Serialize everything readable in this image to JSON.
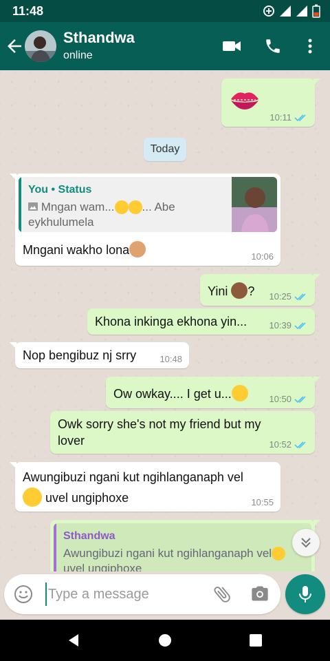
{
  "status_bar": {
    "time": "11:48"
  },
  "header": {
    "contact_name": "Sthandwa",
    "presence": "online"
  },
  "date_divider": "Today",
  "messages": [
    {
      "dir": "out",
      "text": "💋",
      "time": "10:11",
      "ticks": "read"
    },
    {
      "dir": "in",
      "quote_author": "You • Status",
      "quote_line1": "Mngan wam...",
      "quote_line1_tail": "... Abe",
      "quote_line2": "eykhulumela",
      "text": "Mngani wakho lona",
      "time": "10:06"
    },
    {
      "dir": "out",
      "text": "Yini",
      "text_tail": "?",
      "time": "10:25",
      "ticks": "read"
    },
    {
      "dir": "out",
      "text": "Khona inkinga ekhona yin...",
      "time": "10:39",
      "ticks": "read"
    },
    {
      "dir": "in",
      "text": "Nop bengibuz nj srry",
      "time": "10:48"
    },
    {
      "dir": "out",
      "text": "Ow owkay.... I get u...",
      "time": "10:50",
      "ticks": "read"
    },
    {
      "dir": "out",
      "text_line1": "Owk sorry she's not my friend but my",
      "text_line2": "lover",
      "time": "10:52",
      "ticks": "read"
    },
    {
      "dir": "in",
      "text_line1": "Awungibuzi ngani kut ngihlanganaph vel",
      "text_line2": "uvel ungiphoxe",
      "time": "10:55"
    },
    {
      "dir": "out",
      "quote_author": "Sthandwa",
      "quote_line1": "Awungibuzi ngani kut ngihlanganaph vel",
      "quote_line2": "uvel ungiphoxe"
    }
  ],
  "composer": {
    "placeholder": "Type a message"
  },
  "colors": {
    "header": "#075e54",
    "status_bar": "#054d44",
    "outgoing": "#dcf8c6",
    "incoming": "#ffffff",
    "read_ticks": "#4fc3f7",
    "accent": "#128c7e"
  },
  "icons": [
    "back-arrow-icon",
    "video-call-icon",
    "voice-call-icon",
    "more-options-icon",
    "emoji-icon",
    "attach-icon",
    "camera-icon",
    "mic-icon",
    "scroll-down-icon",
    "nav-back-icon",
    "nav-home-icon",
    "nav-recents-icon"
  ]
}
